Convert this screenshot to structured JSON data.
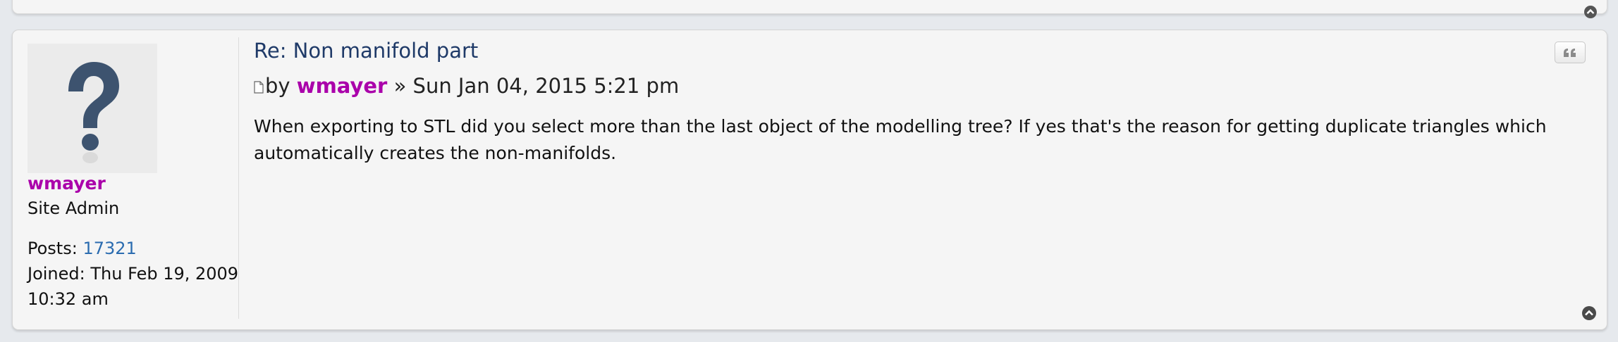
{
  "post": {
    "title": "Re: Non manifold part",
    "meta_by": "by ",
    "author": "wmayer",
    "meta_sep": " » ",
    "datetime": "Sun Jan 04, 2015 5:21 pm",
    "content": "When exporting to STL did you select more than the last object of the modelling tree? If yes that's the reason for getting duplicate triangles which automatically creates the non-manifolds."
  },
  "profile": {
    "username": "wmayer",
    "rank": "Site Admin",
    "posts_label": "Posts: ",
    "posts_count": "17321",
    "joined_label": "Joined: ",
    "joined_value": "Thu Feb 19, 2009 10:32 am"
  },
  "icons": {
    "avatar": "default-avatar-question-mark",
    "post": "document-icon",
    "quote": "quote-icon",
    "back_to_top": "chevron-up-circle-icon"
  },
  "colors": {
    "username": "#aa00aa",
    "title": "#1f3a68",
    "link": "#2b6cb0",
    "panel": "#f5f5f5",
    "page": "#e6e9ed"
  }
}
